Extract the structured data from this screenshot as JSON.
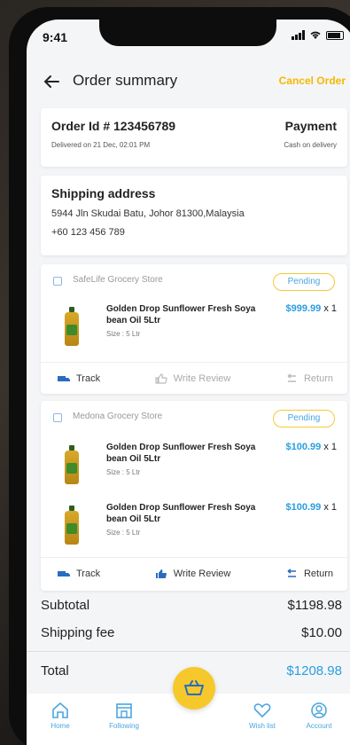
{
  "status": {
    "time": "9:41"
  },
  "header": {
    "title": "Order summary",
    "cancel_label": "Cancel Order"
  },
  "order": {
    "id_label": "Order Id # 123456789",
    "delivered": "Delivered on 21 Dec, 02:01 PM",
    "payment_label": "Payment",
    "payment_value": "Cash on delivery"
  },
  "shipping": {
    "title": "Shipping address",
    "address": "5944 Jln Skudai Batu, Johor 81300,Malaysia",
    "phone": "+60 123 456 789"
  },
  "stores": [
    {
      "name": "SafeLife Grocery Store",
      "status": "Pending",
      "items": [
        {
          "name": "Golden Drop Sunflower Fresh Soya bean Oil 5Ltr",
          "size": "Size : 5 Ltr",
          "price": "$999.99",
          "qty": "x 1"
        }
      ],
      "actions": {
        "track": "Track",
        "review": "Write Review",
        "return": "Return"
      }
    },
    {
      "name": "Medona Grocery Store",
      "status": "Pending",
      "items": [
        {
          "name": "Golden Drop Sunflower Fresh Soya bean Oil 5Ltr",
          "size": "Size : 5 Ltr",
          "price": "$100.99",
          "qty": "x 1"
        },
        {
          "name": "Golden Drop Sunflower Fresh Soya bean Oil 5Ltr",
          "size": "Size : 5 Ltr",
          "price": "$100.99",
          "qty": "x 1"
        }
      ],
      "actions": {
        "track": "Track",
        "review": "Write Review",
        "return": "Return"
      }
    }
  ],
  "summary": {
    "subtotal_label": "Subtotal",
    "subtotal": "$1198.98",
    "shipping_label": "Shipping fee",
    "shipping": "$10.00",
    "total_label": "Total",
    "total": "$1208.98"
  },
  "tabs": [
    {
      "label": "Home",
      "icon": "home-icon"
    },
    {
      "label": "Following",
      "icon": "store-icon"
    },
    {
      "label": "Wish list",
      "icon": "heart-icon"
    },
    {
      "label": "Account",
      "icon": "user-icon"
    }
  ],
  "colors": {
    "accent": "#f6c82b",
    "link": "#2a9ee0",
    "cancel": "#f5b800"
  }
}
